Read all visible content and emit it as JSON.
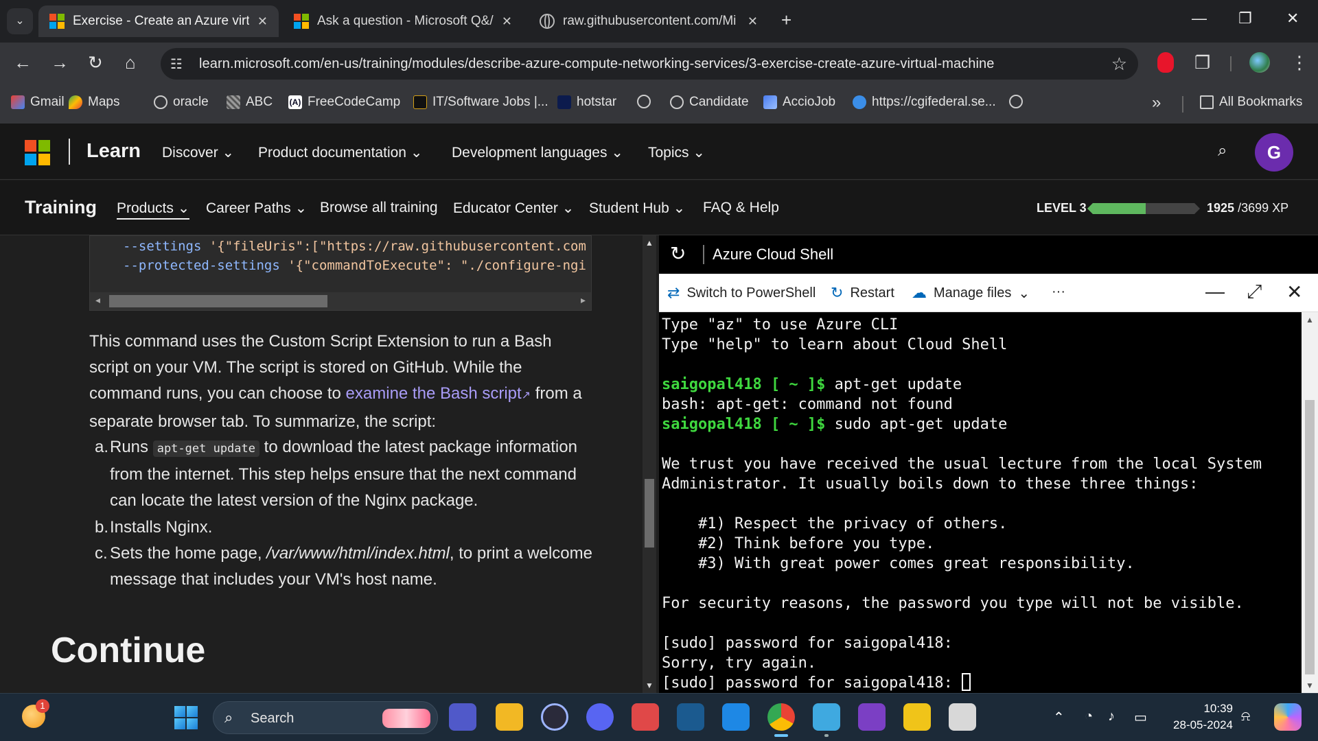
{
  "browser": {
    "tabs": [
      {
        "title": "Exercise - Create an Azure virtu",
        "icon": "microsoft-logo",
        "active": true
      },
      {
        "title": "Ask a question - Microsoft Q&/",
        "icon": "microsoft-logo",
        "active": false
      },
      {
        "title": "raw.githubusercontent.com/Mi",
        "icon": "globe-icon",
        "active": false
      }
    ],
    "url": "learn.microsoft.com/en-us/training/modules/describe-azure-compute-networking-services/3-exercise-create-azure-virtual-machine",
    "bookmarks": [
      {
        "label": "Gmail"
      },
      {
        "label": "Maps"
      },
      {
        "label": "oracle"
      },
      {
        "label": "ABC"
      },
      {
        "label": "FreeCodeCamp"
      },
      {
        "label": "IT/Software Jobs |..."
      },
      {
        "label": "hotstar"
      },
      {
        "label": ""
      },
      {
        "label": "Candidate"
      },
      {
        "label": "AccioJob"
      },
      {
        "label": "https://cgifederal.se..."
      },
      {
        "label": ""
      }
    ],
    "all_bookmarks": "All Bookmarks"
  },
  "learn_header": {
    "brand": "Learn",
    "nav": [
      "Discover",
      "Product documentation",
      "Development languages",
      "Topics"
    ],
    "avatar_letter": "G"
  },
  "training_nav": {
    "title": "Training",
    "items": [
      "Products",
      "Career Paths",
      "Browse all training",
      "Educator Center",
      "Student Hub",
      "FAQ & Help"
    ],
    "level": "LEVEL 3",
    "xp_current": "1925",
    "xp_total": "/3699 XP",
    "xp_fraction": 0.52
  },
  "article": {
    "code_lines": [
      {
        "flag": "--settings",
        "value": " '{\"fileUris\":[\"https://raw.githubusercontent.com"
      },
      {
        "flag": "--protected-settings",
        "value": " '{\"commandToExecute\": \"./configure-ngi"
      }
    ],
    "para_part1": "This command uses the Custom Script Extension to run a Bash script on your VM. The script is stored on GitHub. While the command runs, you can choose to ",
    "para_link": "examine the Bash script",
    "para_part2": " from a separate browser tab. To summarize, the script:",
    "steps": [
      {
        "marker": "a.",
        "before": "Runs ",
        "code": "apt-get update",
        "after": " to download the latest package information from the internet. This step helps ensure that the next command can locate the latest version of the Nginx package."
      },
      {
        "marker": "b.",
        "before": "Installs Nginx.",
        "code": "",
        "after": ""
      },
      {
        "marker": "c.",
        "before": "Sets the home page, ",
        "italic": "/var/www/html/index.html",
        "after": ", to print a welcome message that includes your VM's host name."
      }
    ],
    "continue_heading": "Continue"
  },
  "cloud_shell": {
    "title": "Azure Cloud Shell",
    "toolbar": {
      "switch": "Switch to PowerShell",
      "restart": "Restart",
      "manage_files": "Manage files",
      "more": "···"
    },
    "terminal_lines": [
      {
        "prompt": "",
        "text": "Type \"az\" to use Azure CLI"
      },
      {
        "prompt": "",
        "text": "Type \"help\" to learn about Cloud Shell"
      },
      {
        "prompt": "",
        "text": ""
      },
      {
        "prompt": "saigopal418 [ ~ ]$",
        "text": " apt-get update"
      },
      {
        "prompt": "",
        "text": "bash: apt-get: command not found"
      },
      {
        "prompt": "saigopal418 [ ~ ]$",
        "text": " sudo apt-get update"
      },
      {
        "prompt": "",
        "text": ""
      },
      {
        "prompt": "",
        "text": "We trust you have received the usual lecture from the local System"
      },
      {
        "prompt": "",
        "text": "Administrator. It usually boils down to these three things:"
      },
      {
        "prompt": "",
        "text": ""
      },
      {
        "prompt": "",
        "text": "    #1) Respect the privacy of others."
      },
      {
        "prompt": "",
        "text": "    #2) Think before you type."
      },
      {
        "prompt": "",
        "text": "    #3) With great power comes great responsibility."
      },
      {
        "prompt": "",
        "text": ""
      },
      {
        "prompt": "",
        "text": "For security reasons, the password you type will not be visible."
      },
      {
        "prompt": "",
        "text": ""
      },
      {
        "prompt": "",
        "text": "[sudo] password for saigopal418:"
      },
      {
        "prompt": "",
        "text": "Sorry, try again."
      },
      {
        "prompt": "",
        "text": "[sudo] password for saigopal418: "
      }
    ]
  },
  "taskbar": {
    "notification_count": "1",
    "search_label": "Search",
    "time": "10:39",
    "date": "28-05-2024"
  },
  "colors": {
    "accent_link": "#a99cf7",
    "prompt_green": "#3fd83f",
    "xp_green": "#5fb85f",
    "avatar_purple": "#6b2cad"
  }
}
